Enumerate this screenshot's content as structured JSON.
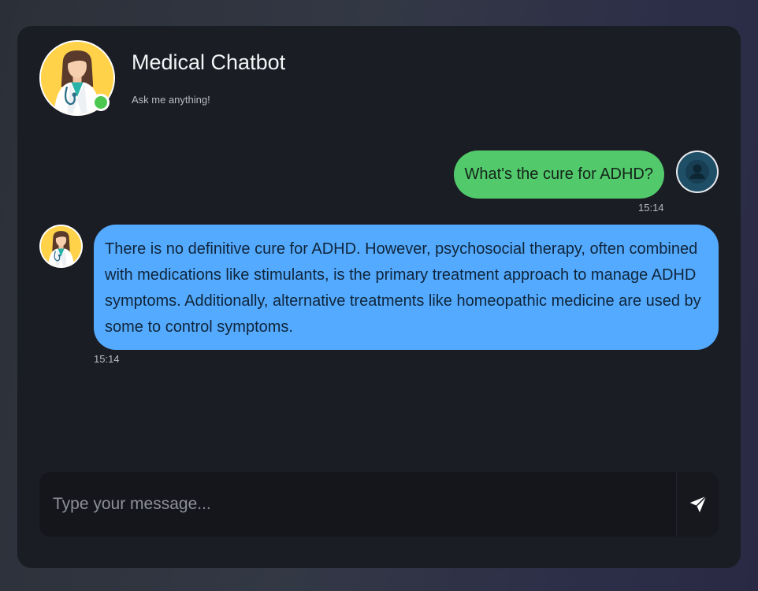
{
  "header": {
    "title": "Medical Chatbot",
    "subtitle": "Ask me anything!",
    "avatar_icon": "doctor-avatar-icon",
    "status": "online",
    "status_color": "#4cc850"
  },
  "messages": [
    {
      "sender": "user",
      "text": "What's the cure for ADHD?",
      "time": "15:14",
      "bubble_color": "#52c96b"
    },
    {
      "sender": "bot",
      "text": "There is no definitive cure for ADHD. However, psychosocial therapy, often combined with medications like stimulants, is the primary treatment approach to manage ADHD symptoms. Additionally, alternative treatments like homeopathic medicine are used by some to control symptoms.",
      "time": "15:14",
      "bubble_color": "#54aaff"
    }
  ],
  "composer": {
    "placeholder": "Type your message...",
    "value": "",
    "send_icon": "send-icon"
  }
}
